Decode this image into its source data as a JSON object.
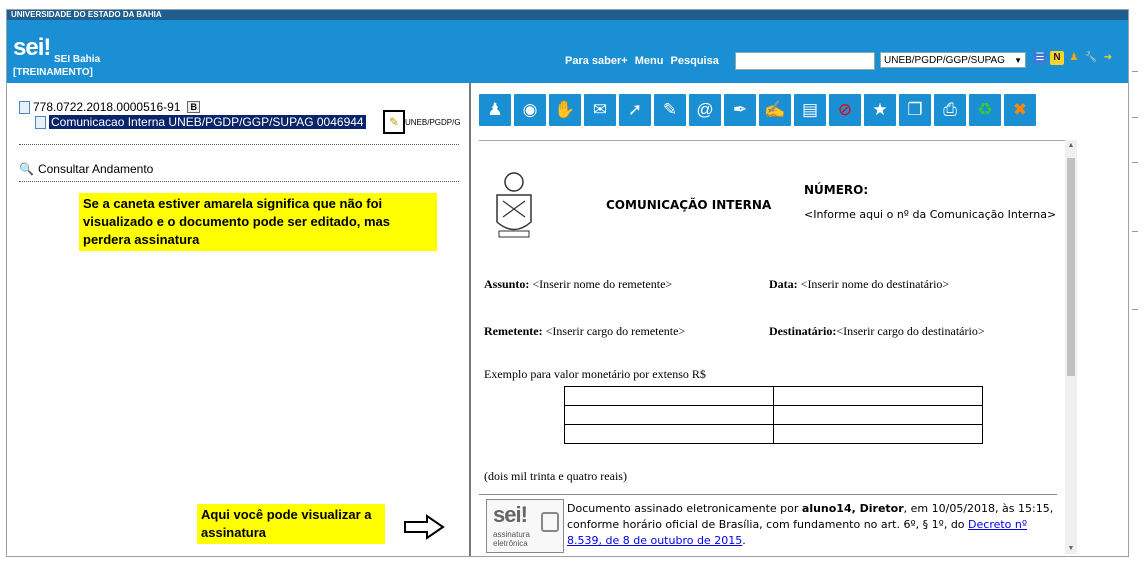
{
  "header": {
    "institution": "UNIVERSIDADE DO ESTADO DA BAHIA",
    "logo": "sei!",
    "system_name": "SEI Bahia",
    "environment": "[TREINAMENTO]",
    "links": [
      "Para saber+",
      "Menu",
      "Pesquisa"
    ],
    "search_value": "",
    "unit": "UNEB/PGDP/GGP/SUPAG",
    "icons": [
      "list-icon",
      "notice-icon",
      "user-icon",
      "tools-icon",
      "exit-icon"
    ]
  },
  "tree": {
    "process_number": "778.0722.2018.0000516-91",
    "process_badge": "B",
    "document_label": "Comunicacao Interna UNEB/PGDP/GGP/SUPAG 0046944",
    "document_unit": "UNEB/PGDP/G",
    "consultar": "Consultar Andamento"
  },
  "notes": {
    "pen_note": "Se a caneta estiver amarela significa que não foi visualizado e o documento pode ser editado, mas perdera assinatura",
    "signature_note": "Aqui você pode visualizar a assinatura"
  },
  "toolbar_icons": [
    "interested-parties-icon",
    "view-icon",
    "assess-icon",
    "send-email-icon",
    "send-process-icon",
    "edit-icon",
    "email-icon",
    "sign-icon",
    "sign-block-icon",
    "book-icon",
    "cancel-icon",
    "favorite-icon",
    "copy-icon",
    "print-icon",
    "recycle-icon",
    "delete-icon"
  ],
  "document": {
    "title": "COMUNICAÇÃO INTERNA",
    "numero_label": "NÚMERO:",
    "numero_placeholder": "<Informe aqui o nº da Comunicação Interna>",
    "assunto_label": "Assunto:",
    "assunto_value": "<Inserir nome do remetente>",
    "data_label": "Data:",
    "data_value": "<Inserir nome do destinatário>",
    "remetente_label": "Remetente:",
    "remetente_value": "<Inserir cargo do remetente>",
    "destinatario_label": "Destinatário:",
    "destinatario_value": "<Inserir cargo do destinatário>",
    "example_line": "Exemplo para valor monetário por extenso R$",
    "amount_words": "(dois mil trinta e quatro reais)",
    "signature": {
      "badge_main": "sei!",
      "badge_sub1": "assinatura",
      "badge_sub2": "eletrônica",
      "text_pre": "Documento assinado eletronicamente por ",
      "signer": "aluno14, Diretor",
      "text_mid": ", em 10/05/2018, às 15:15, conforme horário oficial de Brasília, com fundamento no art. 6º, § 1º, do ",
      "link": "Decreto nº 8.539, de 8 de outubro de 2015",
      "text_end": "."
    }
  },
  "colors": {
    "header_blue": "#1b8fd3",
    "top_strip": "#1f5f90",
    "highlight": "#ffff00",
    "selection": "#0a246a"
  }
}
